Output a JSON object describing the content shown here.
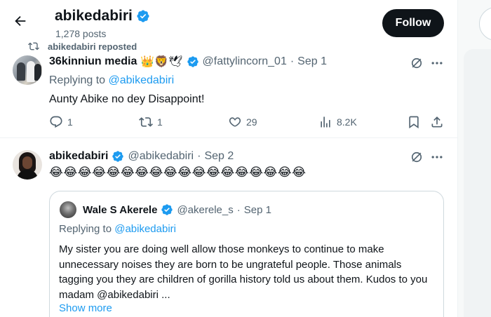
{
  "header": {
    "back_label": "Back",
    "name": "abikedabiri",
    "posts": "1,278 posts",
    "follow_label": "Follow"
  },
  "repost": {
    "text": "abikedabiri reposted"
  },
  "tweet1": {
    "name": "36kinniun media",
    "emojis": "👑🦁🕊",
    "handle": "@fattylincorn_01",
    "dot": "·",
    "date": "Sep 1",
    "replying_prefix": "Replying to ",
    "replying_to": "@abikedabiri",
    "text": "Aunty Abike no dey Disappoint!",
    "replies": "1",
    "reposts": "1",
    "likes": "29",
    "views": "8.2K"
  },
  "tweet2": {
    "name": "abikedabiri",
    "handle": "@abikedabiri",
    "dot": "·",
    "date": "Sep 2",
    "text": "😂😂😂😂😂😂😂😂😂😂😂😂😂😂😂😂😂😂",
    "quote": {
      "name": "Wale S Akerele",
      "handle": "@akerele_s",
      "dot": "·",
      "date": "Sep 1",
      "replying_prefix": "Replying to ",
      "replying_to": "@abikedabiri",
      "text": "My sister you are doing well allow those monkeys to continue to make unnecessary noises they are born to be ungrateful people. Those animals tagging you they are children of gorilla history told us about them.  Kudos to you madam @abikedabiri ...",
      "show_more": "Show more"
    }
  },
  "colors": {
    "accent": "#1d9bf0",
    "text_primary": "#0f1419",
    "text_secondary": "#536471",
    "border": "#cfd9de",
    "follow_bg": "#0f1419"
  },
  "icons": [
    "back-arrow-icon",
    "verified-badge-icon",
    "repost-icon",
    "grok-icon",
    "more-icon",
    "reply-icon",
    "like-icon",
    "views-icon",
    "bookmark-icon",
    "share-icon"
  ]
}
